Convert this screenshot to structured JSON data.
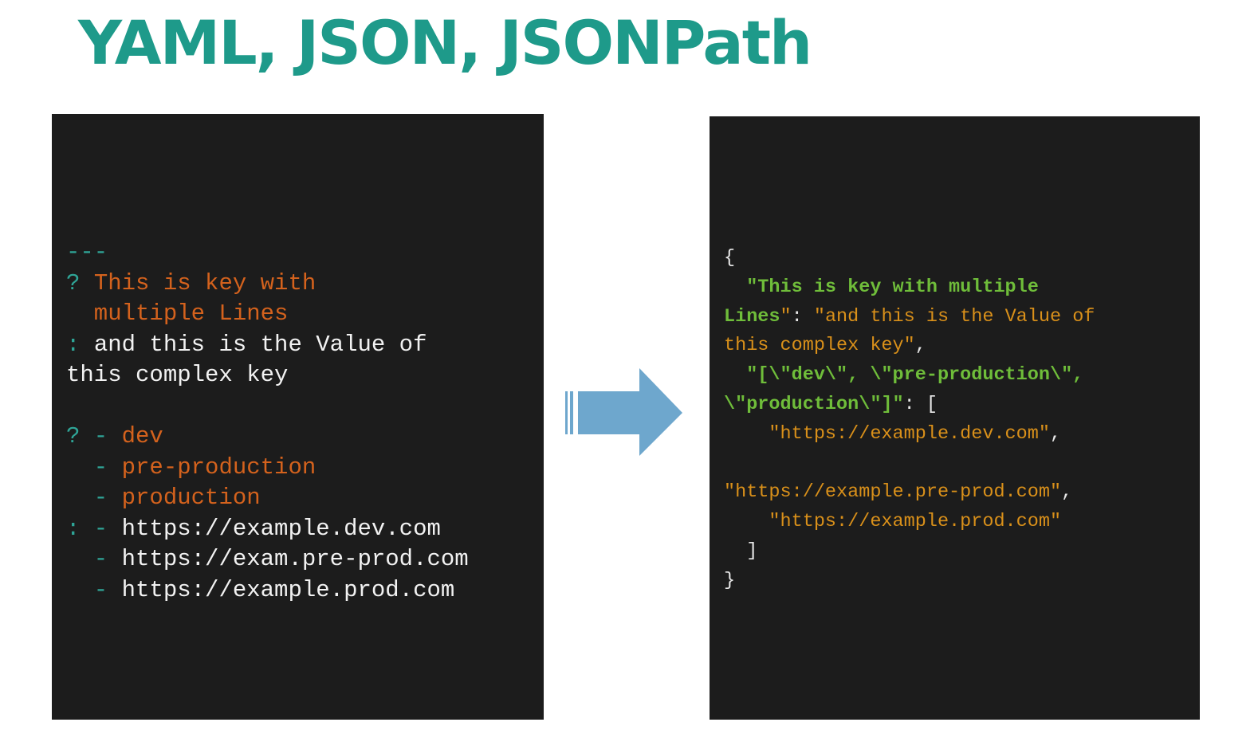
{
  "title": "YAML, JSON, JSONPath",
  "colors": {
    "title": "#1e9a8a",
    "panel_bg": "#1c1c1c",
    "yaml_indicator": "#2fa597",
    "yaml_key": "#d4621d",
    "yaml_text": "#f2f2f2",
    "json_key": "#6fbd3a",
    "json_string": "#d9901a",
    "json_punct": "#e8e8e8",
    "arrow": "#6ea7cd"
  },
  "yaml": {
    "lines": [
      [
        {
          "t": "---",
          "c": "ind"
        }
      ],
      [
        {
          "t": "? ",
          "c": "ind"
        },
        {
          "t": "This is key with",
          "c": "key"
        }
      ],
      [
        {
          "t": "  multiple Lines",
          "c": "key"
        }
      ],
      [
        {
          "t": ": ",
          "c": "ind"
        },
        {
          "t": "and this is the Value of",
          "c": "txt"
        }
      ],
      [
        {
          "t": "this complex key",
          "c": "txt"
        }
      ],
      [],
      [
        {
          "t": "? - ",
          "c": "ind"
        },
        {
          "t": "dev",
          "c": "key"
        }
      ],
      [
        {
          "t": "  - ",
          "c": "ind"
        },
        {
          "t": "pre-production",
          "c": "key"
        }
      ],
      [
        {
          "t": "  - ",
          "c": "ind"
        },
        {
          "t": "production",
          "c": "key"
        }
      ],
      [
        {
          "t": ": - ",
          "c": "ind"
        },
        {
          "t": "https://example.dev.com",
          "c": "txt"
        }
      ],
      [
        {
          "t": "  - ",
          "c": "ind"
        },
        {
          "t": "https://exam.pre-prod.com",
          "c": "txt"
        }
      ],
      [
        {
          "t": "  - ",
          "c": "ind"
        },
        {
          "t": "https://example.prod.com",
          "c": "txt"
        }
      ]
    ]
  },
  "json": {
    "lines": [
      [
        {
          "t": "{",
          "c": "pun"
        }
      ],
      [
        {
          "t": "  \"This is key with multiple",
          "c": "key"
        }
      ],
      [
        {
          "t": "Lines",
          "c": "key"
        },
        {
          "t": "\"",
          "c": "str"
        },
        {
          "t": ": ",
          "c": "pun"
        },
        {
          "t": "\"and this is the Value of",
          "c": "str"
        }
      ],
      [
        {
          "t": "this complex key\"",
          "c": "str"
        },
        {
          "t": ",",
          "c": "pun"
        }
      ],
      [
        {
          "t": "  \"[\\\"dev\\\", \\\"pre-production\\\",",
          "c": "key"
        }
      ],
      [
        {
          "t": "\\\"production\\\"]\"",
          "c": "key"
        },
        {
          "t": ": [",
          "c": "pun"
        }
      ],
      [
        {
          "t": "    \"https://example.dev.com\"",
          "c": "str"
        },
        {
          "t": ",",
          "c": "pun"
        }
      ],
      [],
      [
        {
          "t": "\"https://example.pre-prod.com\"",
          "c": "str"
        },
        {
          "t": ",",
          "c": "pun"
        }
      ],
      [
        {
          "t": "    \"https://example.prod.com\"",
          "c": "str"
        }
      ],
      [
        {
          "t": "  ]",
          "c": "pun"
        }
      ],
      [
        {
          "t": "}",
          "c": "pun"
        }
      ]
    ]
  }
}
